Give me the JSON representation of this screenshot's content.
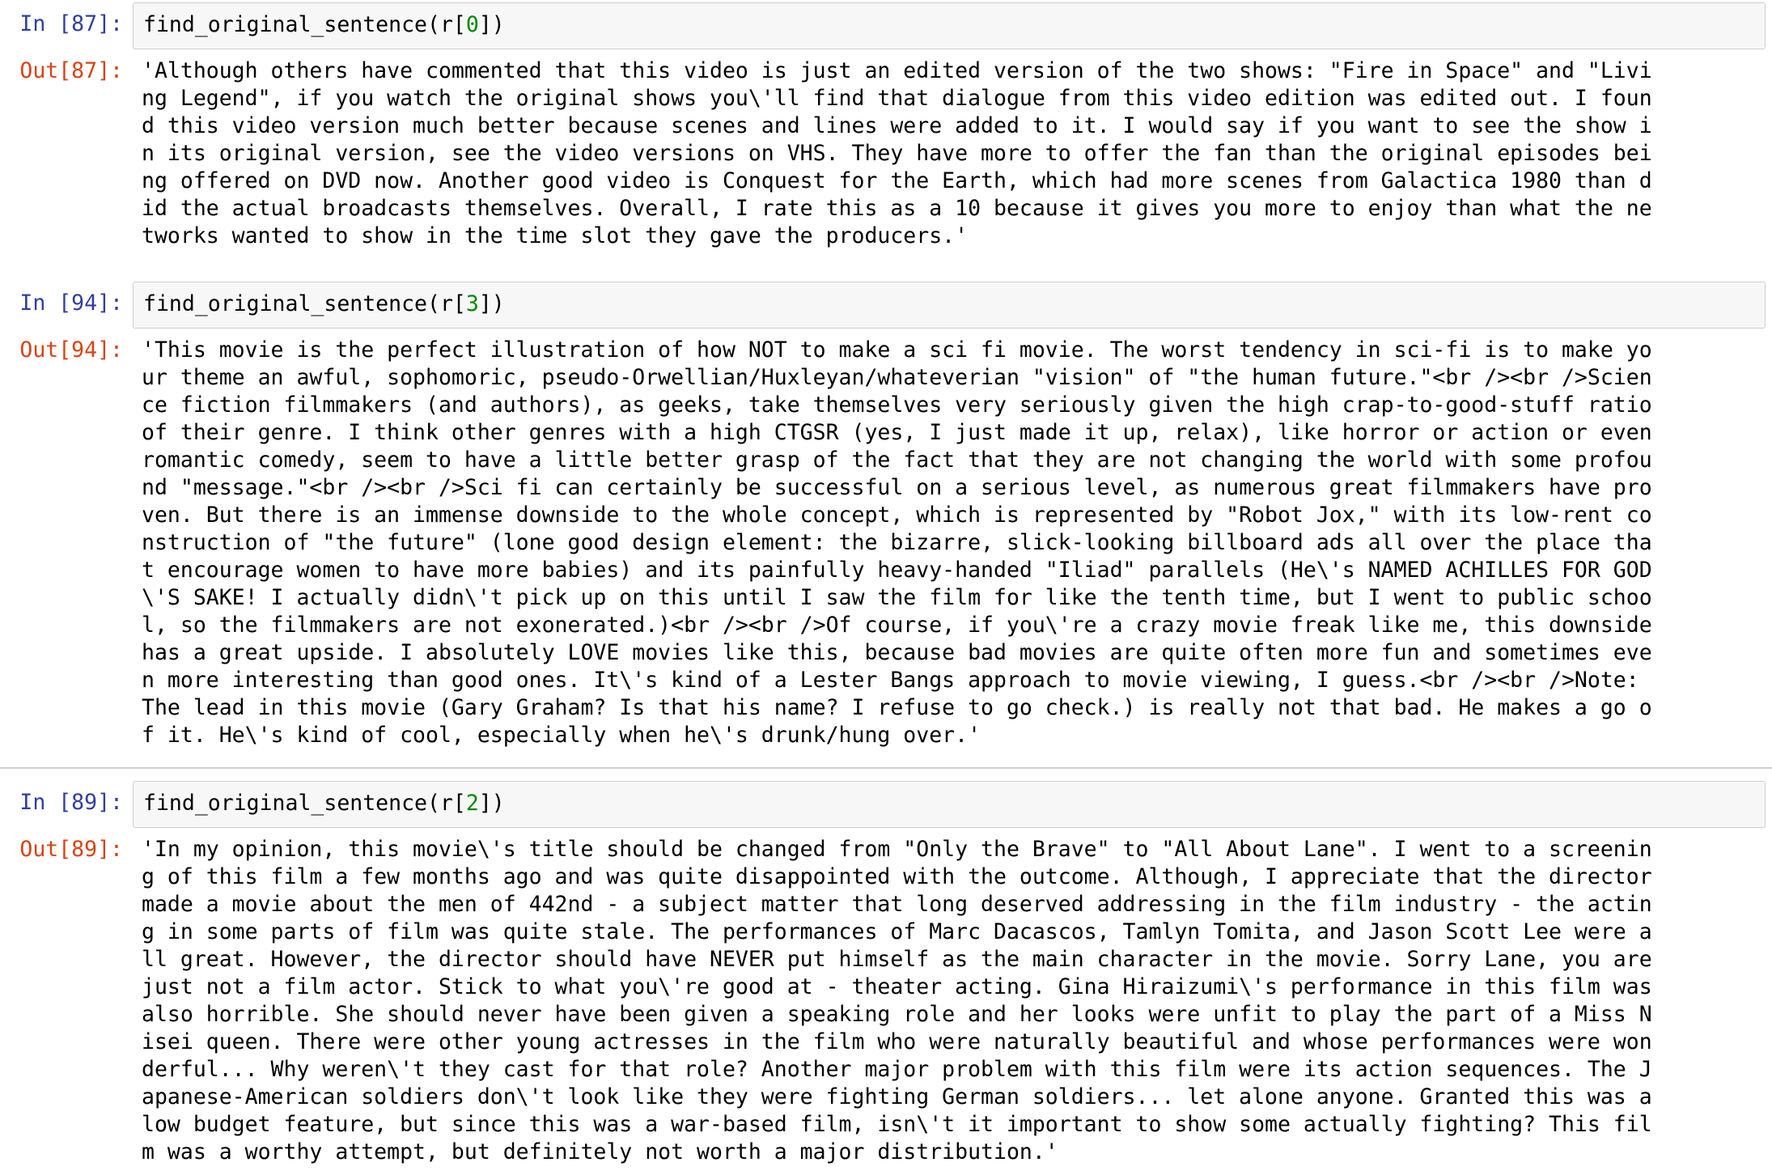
{
  "cells": [
    {
      "in_prompt": "In [87]:",
      "code_fn": "find_original_sentence(r[",
      "code_idx": "0",
      "code_end": "])",
      "out_prompt": "Out[87]:",
      "output_text": "'Although others have commented that this video is just an edited version of the two shows: \"Fire in Space\" and \"Livi\nng Legend\", if you watch the original shows you\\'ll find that dialogue from this video edition was edited out. I foun\nd this video version much better because scenes and lines were added to it. I would say if you want to see the show i\nn its original version, see the video versions on VHS. They have more to offer the fan than the original episodes bei\nng offered on DVD now. Another good video is Conquest for the Earth, which had more scenes from Galactica 1980 than d\nid the actual broadcasts themselves. Overall, I rate this as a 10 because it gives you more to enjoy than what the ne\ntworks wanted to show in the time slot they gave the producers.'"
    },
    {
      "in_prompt": "In [94]:",
      "code_fn": "find_original_sentence(r[",
      "code_idx": "3",
      "code_end": "])",
      "out_prompt": "Out[94]:",
      "output_text": "'This movie is the perfect illustration of how NOT to make a sci fi movie. The worst tendency in sci-fi is to make yo\nur theme an awful, sophomoric, pseudo-Orwellian/Huxleyan/whateverian \"vision\" of \"the human future.\"<br /><br />Scien\nce fiction filmmakers (and authors), as geeks, take themselves very seriously given the high crap-to-good-stuff ratio\nof their genre. I think other genres with a high CTGSR (yes, I just made it up, relax), like horror or action or even\nromantic comedy, seem to have a little better grasp of the fact that they are not changing the world with some profou\nnd \"message.\"<br /><br />Sci fi can certainly be successful on a serious level, as numerous great filmmakers have pro\nven. But there is an immense downside to the whole concept, which is represented by \"Robot Jox,\" with its low-rent co\nnstruction of \"the future\" (lone good design element: the bizarre, slick-looking billboard ads all over the place tha\nt encourage women to have more babies) and its painfully heavy-handed \"Iliad\" parallels (He\\'s NAMED ACHILLES FOR GOD\n\\'S SAKE! I actually didn\\'t pick up on this until I saw the film for like the tenth time, but I went to public schoo\nl, so the filmmakers are not exonerated.)<br /><br />Of course, if you\\'re a crazy movie freak like me, this downside\nhas a great upside. I absolutely LOVE movies like this, because bad movies are quite often more fun and sometimes eve\nn more interesting than good ones. It\\'s kind of a Lester Bangs approach to movie viewing, I guess.<br /><br />Note:\nThe lead in this movie (Gary Graham? Is that his name? I refuse to go check.) is really not that bad. He makes a go o\nf it. He\\'s kind of cool, especially when he\\'s drunk/hung over.'"
    },
    {
      "in_prompt": "In [89]:",
      "code_fn": "find_original_sentence(r[",
      "code_idx": "2",
      "code_end": "])",
      "out_prompt": "Out[89]:",
      "output_text": "'In my opinion, this movie\\'s title should be changed from \"Only the Brave\" to \"All About Lane\". I went to a screenin\ng of this film a few months ago and was quite disappointed with the outcome. Although, I appreciate that the director\nmade a movie about the men of 442nd - a subject matter that long deserved addressing in the film industry - the actin\ng in some parts of film was quite stale. The performances of Marc Dacascos, Tamlyn Tomita, and Jason Scott Lee were a\nll great. However, the director should have NEVER put himself as the main character in the movie. Sorry Lane, you are\njust not a film actor. Stick to what you\\'re good at - theater acting. Gina Hiraizumi\\'s performance in this film was\nalso horrible. She should never have been given a speaking role and her looks were unfit to play the part of a Miss N\nisei queen. There were other young actresses in the film who were naturally beautiful and whose performances were won\nderful... Why weren\\'t they cast for that role? Another major problem with this film were its action sequences. The J\napanese-American soldiers don\\'t look like they were fighting German soldiers... let alone anyone. Granted this was a\nlow budget feature, but since this was a war-based film, isn\\'t it important to show some actually fighting? This fil\nm was a worthy attempt, but definitely not worth a major distribution.'"
    }
  ]
}
